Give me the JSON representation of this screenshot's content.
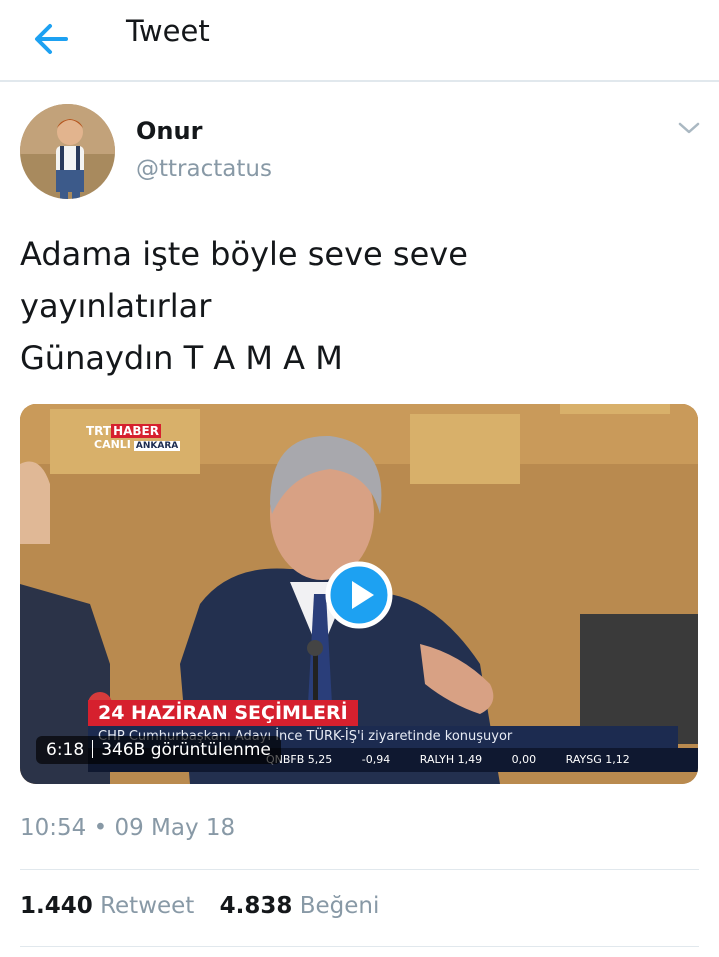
{
  "header": {
    "title": "Tweet",
    "back_icon": "arrow-left-icon",
    "accent_color": "#1da1f2"
  },
  "author": {
    "name": "Onur",
    "handle": "@ttractatus",
    "menu_icon": "chevron-down-icon"
  },
  "tweet": {
    "lines": [
      "Adama işte böyle seve seve",
      "yayınlatırlar",
      "Günaydın T A M A M"
    ]
  },
  "video": {
    "duration": "6:18",
    "views": "346B görüntülenme",
    "play_icon": "play-icon",
    "channel": {
      "brand": "TRT",
      "program": "HABER",
      "live": "CANLI",
      "city": "ANKARA"
    },
    "headline": "24 HAZİRAN SEÇİMLERİ",
    "caption": "CHP Cumhurbaşkanı Adayı İnce TÜRK-İŞ'i ziyaretinde konuşuyor",
    "ticker": [
      "QNBFB 5,25",
      "-0,94",
      "RALYH 1,49",
      "0,00",
      "RAYSG 1,12"
    ]
  },
  "meta": {
    "timestamp": "10:54 • 09 May 18"
  },
  "stats": {
    "retweet_count": "1.440",
    "retweet_label": "Retweet",
    "like_count": "4.838",
    "like_label": "Beğeni"
  }
}
